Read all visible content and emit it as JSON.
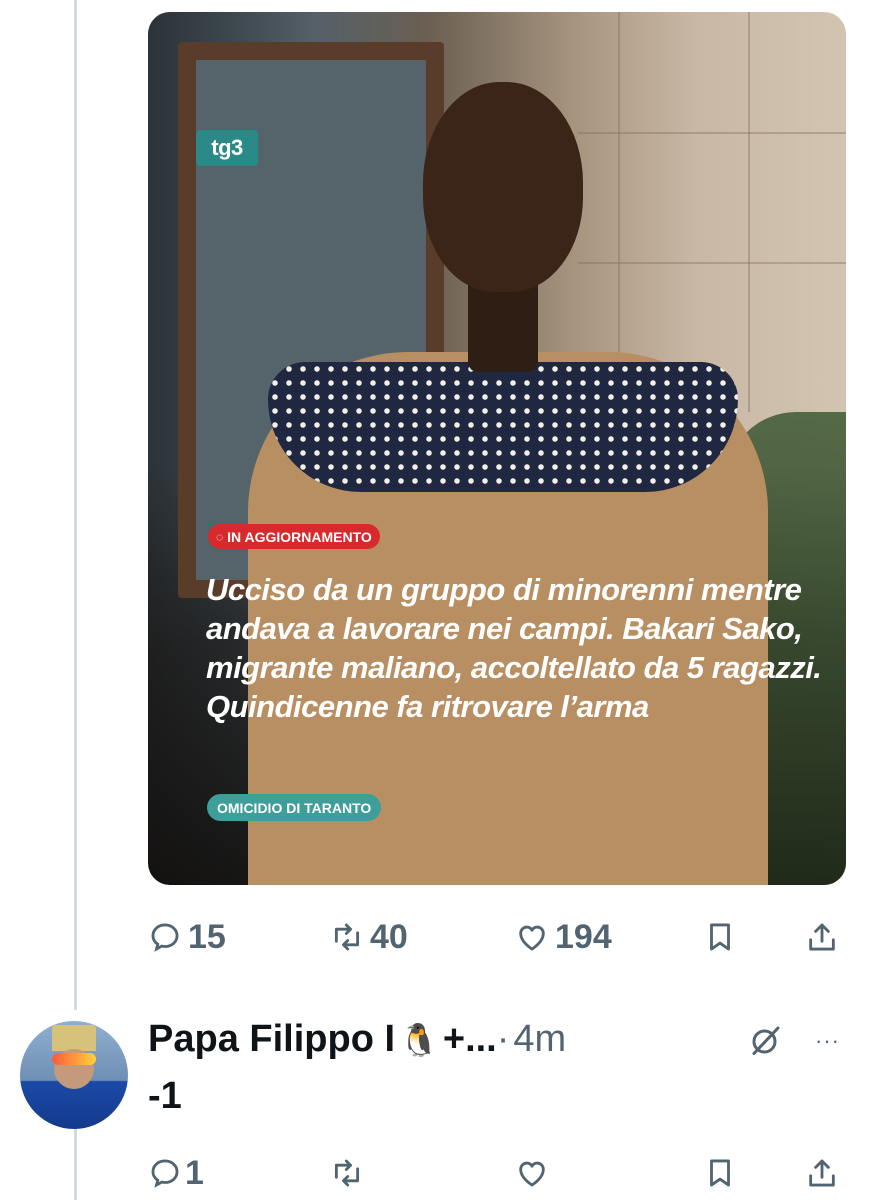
{
  "post": {
    "media": {
      "logo_text": "tg3",
      "live_badge": "IN AGGIORNAMENTO",
      "headline": "Ucciso da un gruppo di minorenni mentre andava a lavorare nei campi. Bakari Sako, migrante maliano, accoltellato da 5 ragazzi. Quindicenne fa ritrovare l’arma",
      "topic_badge": "OMICIDIO DI TARANTO"
    },
    "actions": {
      "replies": "15",
      "reposts": "40",
      "likes": "194"
    }
  },
  "reply": {
    "author_name": "Papa Filippo I",
    "author_emoji": "🐧",
    "author_suffix": "+...",
    "separator": "·",
    "time": "4m",
    "more": "···",
    "text": "-1",
    "actions": {
      "replies": "1",
      "reposts": "",
      "likes": ""
    }
  },
  "colors": {
    "icon_gray": "#536471",
    "live_red": "#d8292c",
    "topic_teal": "#3d9e9a",
    "thread_line": "#cfd9de"
  }
}
